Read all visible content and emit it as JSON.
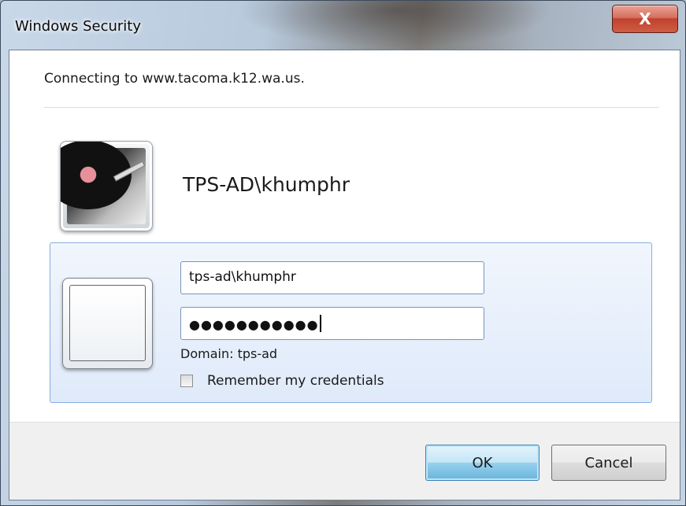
{
  "window": {
    "title": "Windows Security",
    "close_glyph": "X"
  },
  "dialog": {
    "connecting_text": "Connecting to www.tacoma.k12.wa.us.",
    "account_name": "TPS-AD\\khumphr"
  },
  "credentials": {
    "username_value": "tps-ad\\khumphr",
    "password_masked": "●●●●●●●●●●●",
    "domain_text": "Domain: tps-ad",
    "remember_label": "Remember my credentials",
    "remember_checked": false
  },
  "buttons": {
    "ok_label": "OK",
    "cancel_label": "Cancel"
  },
  "icons": {
    "user_tile": "turntable-user-picture",
    "blank_tile": "blank-user-picture"
  }
}
